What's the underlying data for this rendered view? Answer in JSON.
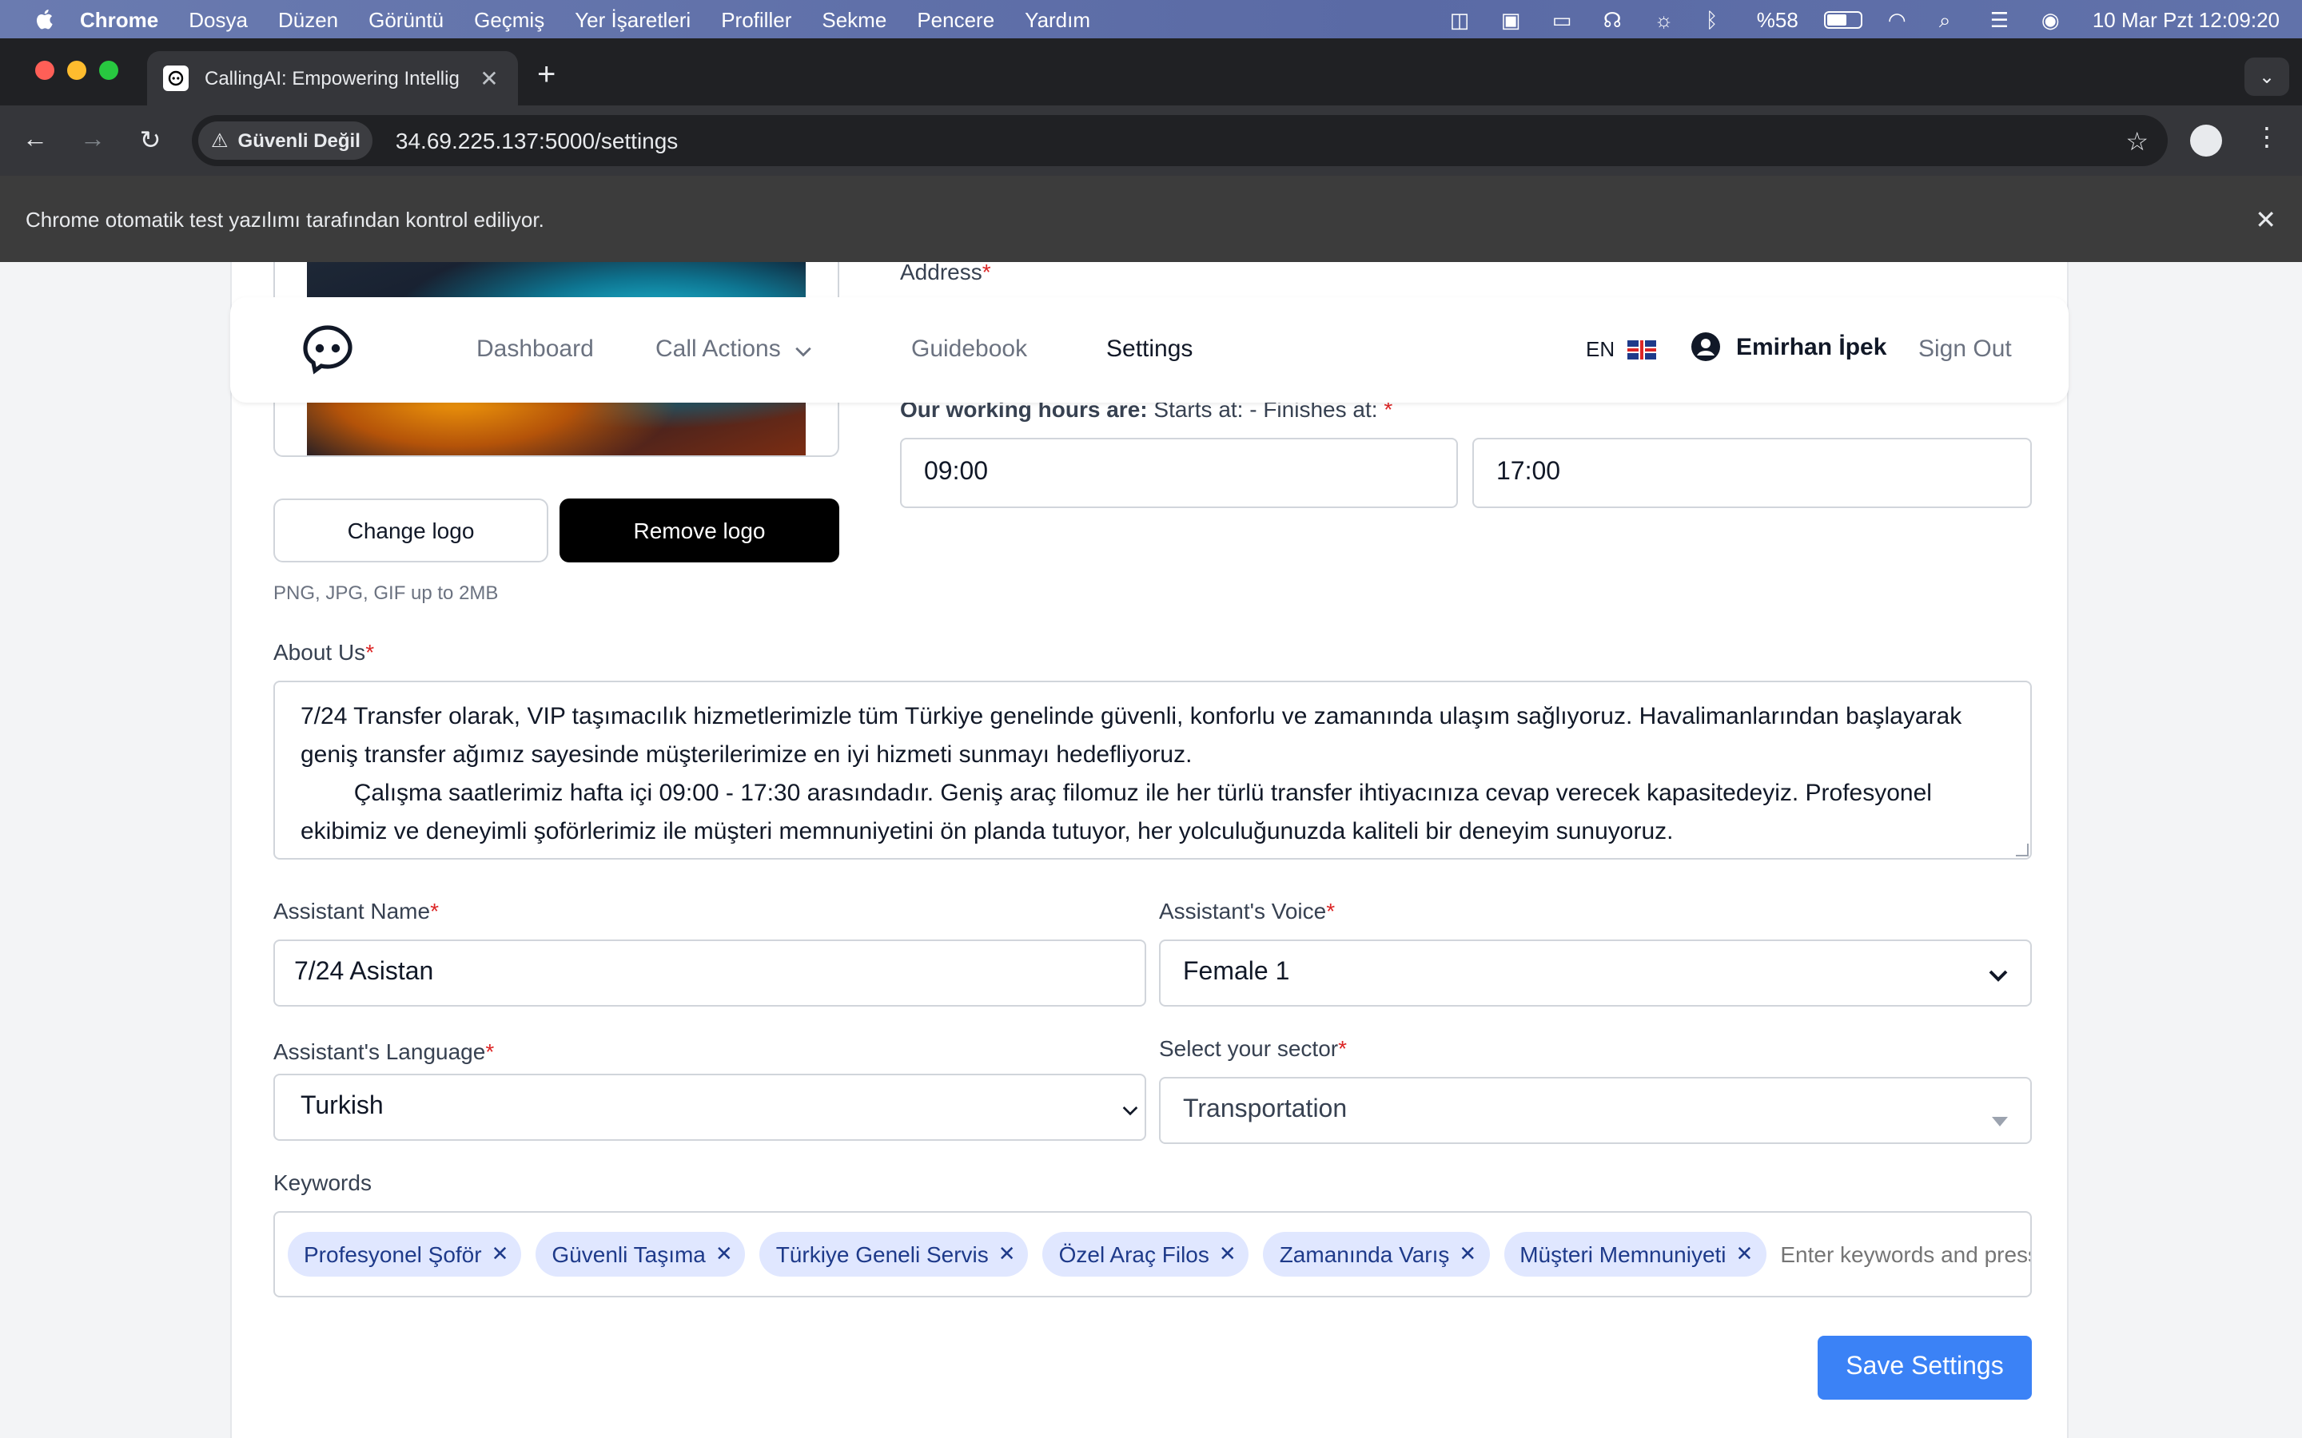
{
  "menubar": {
    "app_name": "Chrome",
    "items": [
      "Dosya",
      "Düzen",
      "Görüntü",
      "Geçmiş",
      "Yer İşaretleri",
      "Profiller",
      "Sekme",
      "Pencere",
      "Yardım"
    ],
    "battery": "%58",
    "datetime": "10 Mar Pzt  12:09:20"
  },
  "browser": {
    "tab_title": "CallingAI: Empowering Intellig",
    "security_label": "Güvenli Değil",
    "url": "34.69.225.137:5000/settings",
    "infobar_text": "Chrome otomatik test yazılımı tarafından kontrol ediliyor."
  },
  "nav": {
    "links": [
      "Dashboard",
      "Call Actions",
      "Guidebook",
      "Settings"
    ],
    "active": "Settings",
    "lang": "EN",
    "user_name": "Emirhan İpek",
    "sign_out": "Sign Out"
  },
  "logo": {
    "change_label": "Change logo",
    "remove_label": "Remove logo",
    "hint": "PNG, JPG, GIF up to 2MB"
  },
  "address": {
    "label": "Address"
  },
  "hours": {
    "label_bold": "Our working hours are:",
    "label_rest": "Starts at: - Finishes at:",
    "start": "09:00",
    "end": "17:00"
  },
  "about": {
    "label": "About Us",
    "text": "7/24 Transfer olarak, VIP taşımacılık hizmetlerimizle tüm Türkiye genelinde güvenli, konforlu ve zamanında ulaşım sağlıyoruz. Havalimanlarından başlayarak geniş transfer ağımız sayesinde müşterilerimize en iyi hizmeti sunmayı hedefliyoruz.\n        Çalışma saatlerimiz hafta içi 09:00 - 17:30 arasındadır. Geniş araç filomuz ile her türlü transfer ihtiyacınıza cevap verecek kapasitedeyiz. Profesyonel ekibimiz ve deneyimli şoförlerimiz ile müşteri memnuniyetini ön planda tutuyor, her yolculuğunuzda kaliteli bir deneyim sunuyoruz."
  },
  "assistant": {
    "name_label": "Assistant Name",
    "name_value": "7/24 Asistan",
    "voice_label": "Assistant's Voice",
    "voice_value": "Female 1",
    "language_label": "Assistant's Language",
    "language_value": "Turkish",
    "sector_label": "Select your sector",
    "sector_value": "Transportation"
  },
  "keywords": {
    "label": "Keywords",
    "chips": [
      "Profesyonel Şoför",
      "Güvenli Taşıma",
      "Türkiye Geneli Servis",
      "Özel Araç Filos",
      "Zamanında Varış",
      "Müşteri Memnuniyeti"
    ],
    "placeholder": "Enter keywords and press Enter"
  },
  "save_label": "Save Settings",
  "colors": {
    "primary": "#3b82f6",
    "chip_bg": "#e0e7ff",
    "required": "#dc2626"
  }
}
